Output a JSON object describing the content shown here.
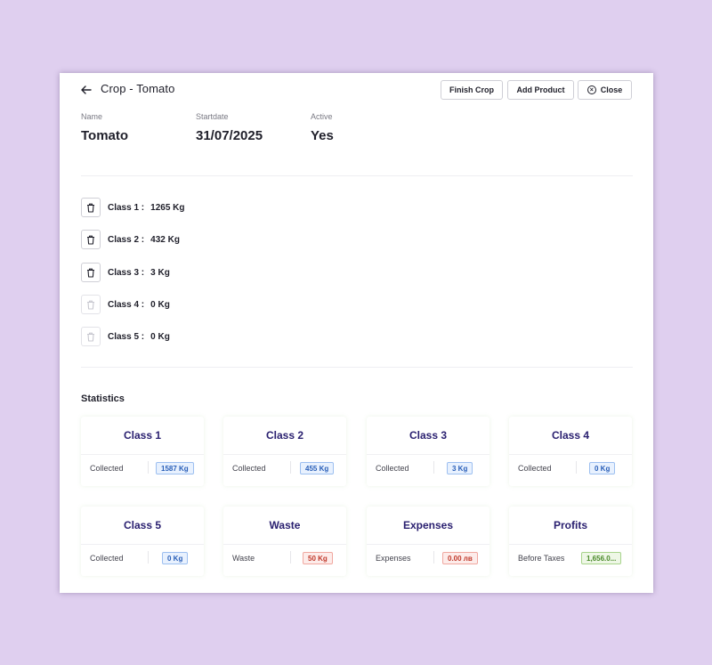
{
  "header": {
    "title": "Crop - Tomato",
    "finish_label": "Finish Crop",
    "add_label": "Add Product",
    "close_label": "Close"
  },
  "info": {
    "name_label": "Name",
    "name_value": "Tomato",
    "start_label": "Startdate",
    "start_value": "31/07/2025",
    "active_label": "Active",
    "active_value": "Yes"
  },
  "classes": [
    {
      "label": "Class 1 :",
      "value": "1265 Kg",
      "enabled": true
    },
    {
      "label": "Class 2 :",
      "value": "432 Kg",
      "enabled": true
    },
    {
      "label": "Class 3 :",
      "value": "3 Kg",
      "enabled": true
    },
    {
      "label": "Class 4 :",
      "value": "0 Kg",
      "enabled": false
    },
    {
      "label": "Class 5 :",
      "value": "0 Kg",
      "enabled": false
    }
  ],
  "statistics": {
    "title": "Statistics",
    "cards": [
      {
        "title": "Class 1",
        "label": "Collected",
        "value": "1587 Kg",
        "tone": "blue"
      },
      {
        "title": "Class 2",
        "label": "Collected",
        "value": "455 Kg",
        "tone": "blue"
      },
      {
        "title": "Class 3",
        "label": "Collected",
        "value": "3 Kg",
        "tone": "blue"
      },
      {
        "title": "Class 4",
        "label": "Collected",
        "value": "0 Kg",
        "tone": "blue"
      },
      {
        "title": "Class 5",
        "label": "Collected",
        "value": "0 Kg",
        "tone": "blue"
      },
      {
        "title": "Waste",
        "label": "Waste",
        "value": "50 Kg",
        "tone": "red"
      },
      {
        "title": "Expenses",
        "label": "Expenses",
        "value": "0.00 лв",
        "tone": "red"
      },
      {
        "title": "Profits",
        "label": "Before Taxes",
        "value": "1,656.0...",
        "tone": "green"
      }
    ]
  },
  "icons": {
    "back": "arrow-left-icon",
    "close": "close-circle-icon",
    "trash": "trash-icon"
  },
  "colors": {
    "background": "#dfcfef",
    "card_title": "#2a2070",
    "badge_blue": "#2a5fb8",
    "badge_red": "#c0392b",
    "badge_green": "#4a8a2a"
  }
}
